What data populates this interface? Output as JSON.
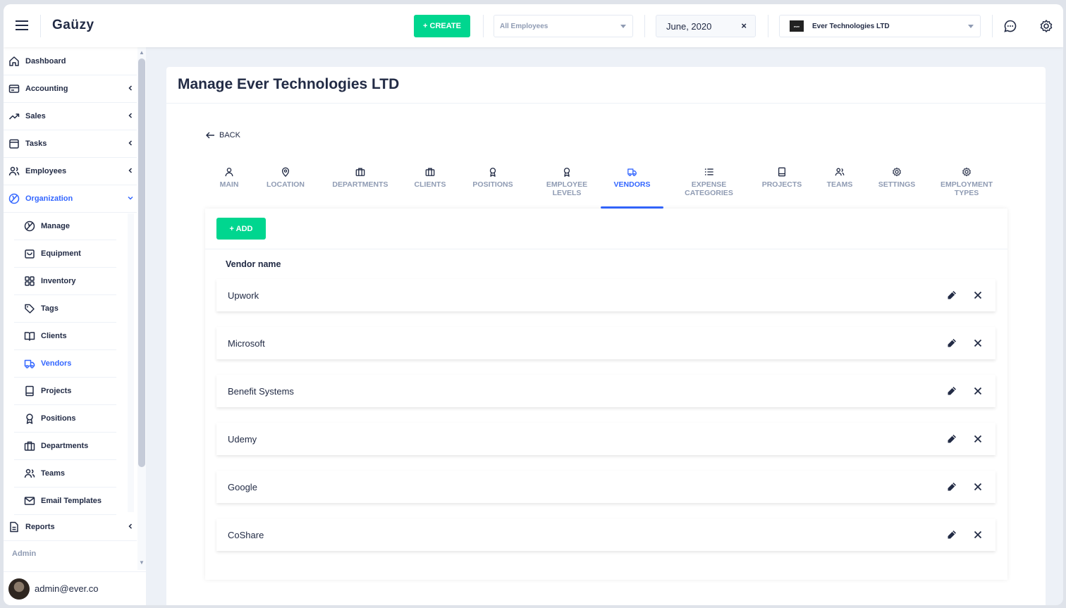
{
  "header": {
    "logo": "Gaüzy",
    "create_label": "+ CREATE",
    "employee_select": "All Employees",
    "date_value": "June, 2020",
    "date_clear": "×",
    "org_select": "Ever Technologies LTD",
    "org_logo_text": "ever"
  },
  "sidebar": {
    "items": [
      {
        "label": "Dashboard",
        "icon": "home-icon"
      },
      {
        "label": "Accounting",
        "icon": "credit-card-icon"
      },
      {
        "label": "Sales",
        "icon": "trending-up-icon"
      },
      {
        "label": "Tasks",
        "icon": "calendar-icon"
      },
      {
        "label": "Employees",
        "icon": "people-icon"
      },
      {
        "label": "Organization",
        "icon": "globe-icon"
      }
    ],
    "sub_items": [
      {
        "label": "Manage",
        "icon": "globe-icon"
      },
      {
        "label": "Equipment",
        "icon": "shopping-bag-icon"
      },
      {
        "label": "Inventory",
        "icon": "grid-icon"
      },
      {
        "label": "Tags",
        "icon": "tag-icon"
      },
      {
        "label": "Clients",
        "icon": "book-open-icon"
      },
      {
        "label": "Vendors",
        "icon": "car-icon"
      },
      {
        "label": "Projects",
        "icon": "book-icon"
      },
      {
        "label": "Positions",
        "icon": "award-icon"
      },
      {
        "label": "Departments",
        "icon": "briefcase-icon"
      },
      {
        "label": "Teams",
        "icon": "people-icon"
      },
      {
        "label": "Email Templates",
        "icon": "email-icon"
      }
    ],
    "reports": "Reports",
    "admin": "Admin",
    "user_email": "admin@ever.co"
  },
  "main": {
    "title": "Manage Ever Technologies LTD",
    "back": "BACK",
    "tabs": [
      {
        "line1": "MAIN",
        "line2": "",
        "icon": "person-icon"
      },
      {
        "line1": "LOCATION",
        "line2": "",
        "icon": "pin-icon"
      },
      {
        "line1": "DEPARTMENTS",
        "line2": "",
        "icon": "briefcase-icon"
      },
      {
        "line1": "CLIENTS",
        "line2": "",
        "icon": "briefcase-icon"
      },
      {
        "line1": "POSITIONS",
        "line2": "",
        "icon": "award-icon"
      },
      {
        "line1": "EMPLOYEE",
        "line2": "LEVELS",
        "icon": "award-icon"
      },
      {
        "line1": "VENDORS",
        "line2": "",
        "icon": "car-icon"
      },
      {
        "line1": "EXPENSE",
        "line2": "CATEGORIES",
        "icon": "list-icon"
      },
      {
        "line1": "PROJECTS",
        "line2": "",
        "icon": "book-icon"
      },
      {
        "line1": "TEAMS",
        "line2": "",
        "icon": "people-icon"
      },
      {
        "line1": "SETTINGS",
        "line2": "",
        "icon": "settings-icon"
      },
      {
        "line1": "EMPLOYMENT",
        "line2": "TYPES",
        "icon": "settings-icon"
      }
    ],
    "add_label": "+ ADD",
    "column_header": "Vendor name",
    "vendors": [
      "Upwork",
      "Microsoft",
      "Benefit Systems",
      "Udemy",
      "Google",
      "CoShare"
    ]
  },
  "colors": {
    "accent": "#3366ff",
    "success": "#00d68f",
    "text": "#222b45",
    "muted": "#8f9bb3"
  }
}
